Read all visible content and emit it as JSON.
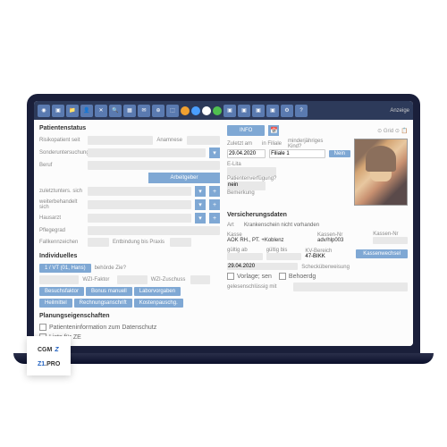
{
  "toolbar": {
    "items": [
      "Benutzer",
      "Speichern",
      "Neu",
      "Patient",
      "Löschen",
      "Suchen",
      "RIO-Sync",
      "Brief",
      "Mail",
      "BFS",
      "WZ",
      "eDMP/eHKS"
    ],
    "right_label": "Anzeige"
  },
  "left": {
    "section1_title": "Patientenstatus",
    "rows": [
      {
        "label": "Risikopatient seit",
        "field": "",
        "extra": "Anamnese"
      },
      {
        "label": "Sonderuntersuchung",
        "field": ""
      },
      {
        "label": "Beruf",
        "field": ""
      }
    ],
    "arbeitgeber_btn": "Arbeitgeber",
    "rows2": [
      {
        "label": "zuletztunters. sich"
      },
      {
        "label": "weiterbehandelt sich"
      },
      {
        "label": "Hausarzt"
      },
      {
        "label": "Pflegegrad"
      },
      {
        "label": "Fallkennzeichen",
        "extra": "Entbindung bis Praxis"
      }
    ],
    "section2_title": "Individuelles",
    "buttons": [
      "1 / VT (01, Hans)",
      "WZI-Faktor",
      "WZI-Zuschuss"
    ],
    "tags": [
      "Besuchsfaktor",
      "Bonus manuell",
      "Laborvorgaben",
      "Heilmittel",
      "Rechnungsanschrift",
      "Kostenpauschg."
    ],
    "section3_title": "Planungseigenschaften",
    "checks": [
      "Patienteninformation zum Datenschutz",
      "Liste für ZE"
    ]
  },
  "right": {
    "info_btn": "INFO",
    "zuletzt_label": "Zuletzt am",
    "date1": "29.04.2020",
    "filiale_label": "in Filiale",
    "filiale_value": "Filiale 1",
    "minder_label": "minderjähriges Kind?",
    "minder_btn": "Nein",
    "ek_label": "E-Lita",
    "pv_label": "Patientenverfügung?",
    "pv_value": "nein",
    "bem_label": "Bemerkung",
    "section_title": "Versicherungsdaten",
    "art_label": "Art",
    "art_value": "Krankenschein nicht vorhanden",
    "kasse_label": "Kasse",
    "kasse_value": "AOK RH., PT. +Koblenz",
    "kassennr_label": "Kassen-Nr",
    "kassennr_value": "adv/hlp003",
    "gultig_ab": "gültig ab",
    "gultig_bis": "gültig bis",
    "kvbereich": "KV-Bereich",
    "kvbereich_value": "47-BIKK",
    "kz_btn": "Kassenwechsel",
    "date2": "29.04.2020",
    "scheck_label": "Schecküberweisung",
    "vorlage": "Vorlage; sen",
    "behoerdg": "Behoerdg",
    "gelesen_label": "gelesenschlüssig mit"
  },
  "logo": {
    "line1": "CGM",
    "line2_a": "Z1",
    "line2_b": ".PRO"
  }
}
